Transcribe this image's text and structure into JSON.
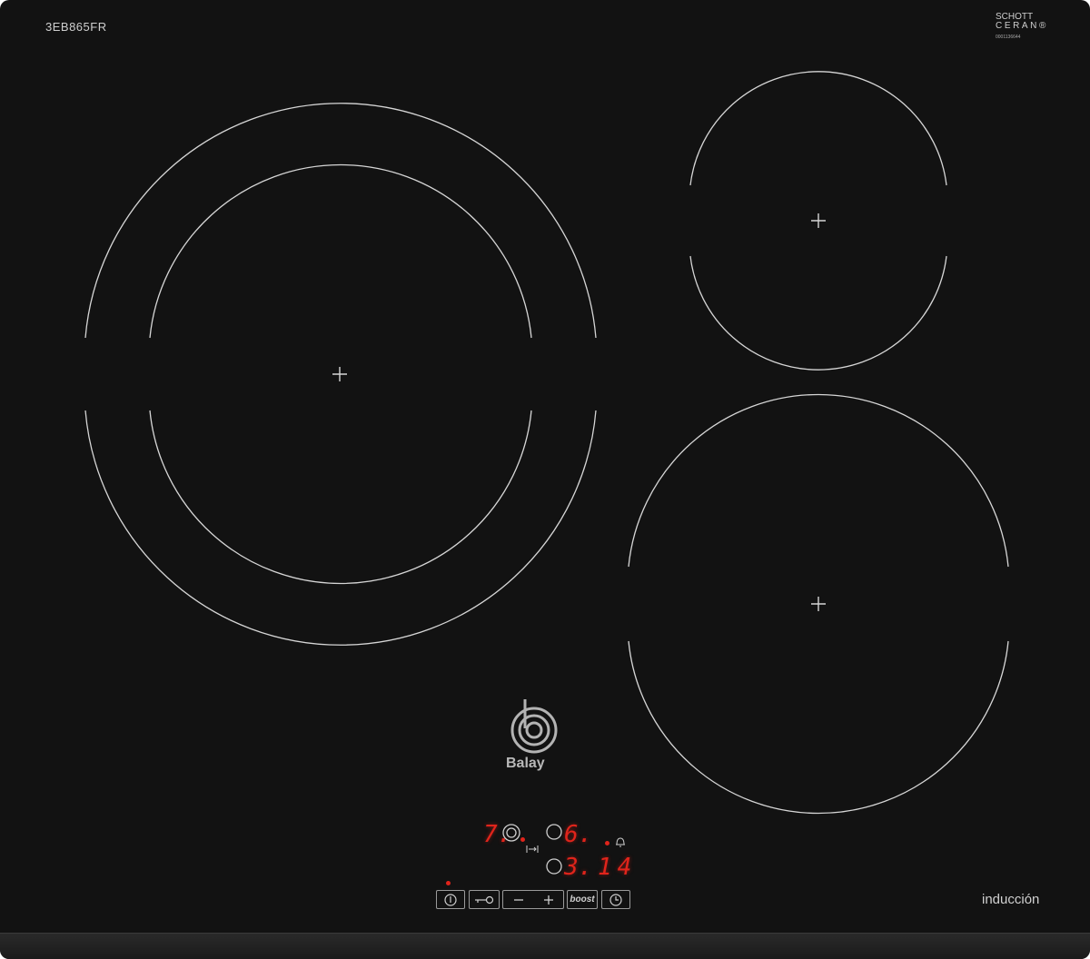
{
  "model_number": "3EB865FR",
  "glass_maker": {
    "line1": "SCHOTT",
    "line2": "CERAN",
    "registered": "®",
    "code": "0001136644"
  },
  "brand": "Balay",
  "technology_label": "inducción",
  "display": {
    "zone_left_level": "7.",
    "zone_front_right_level": "6.",
    "zone_back_right_level": "3.",
    "timer_minutes": "14"
  },
  "controls": [
    "power",
    "child-lock",
    "minus",
    "plus",
    "boost",
    "timer"
  ],
  "boost_label": "boost",
  "colors": {
    "glass": "#121212",
    "print": "#cfcfcf",
    "led": "#e0241b"
  }
}
